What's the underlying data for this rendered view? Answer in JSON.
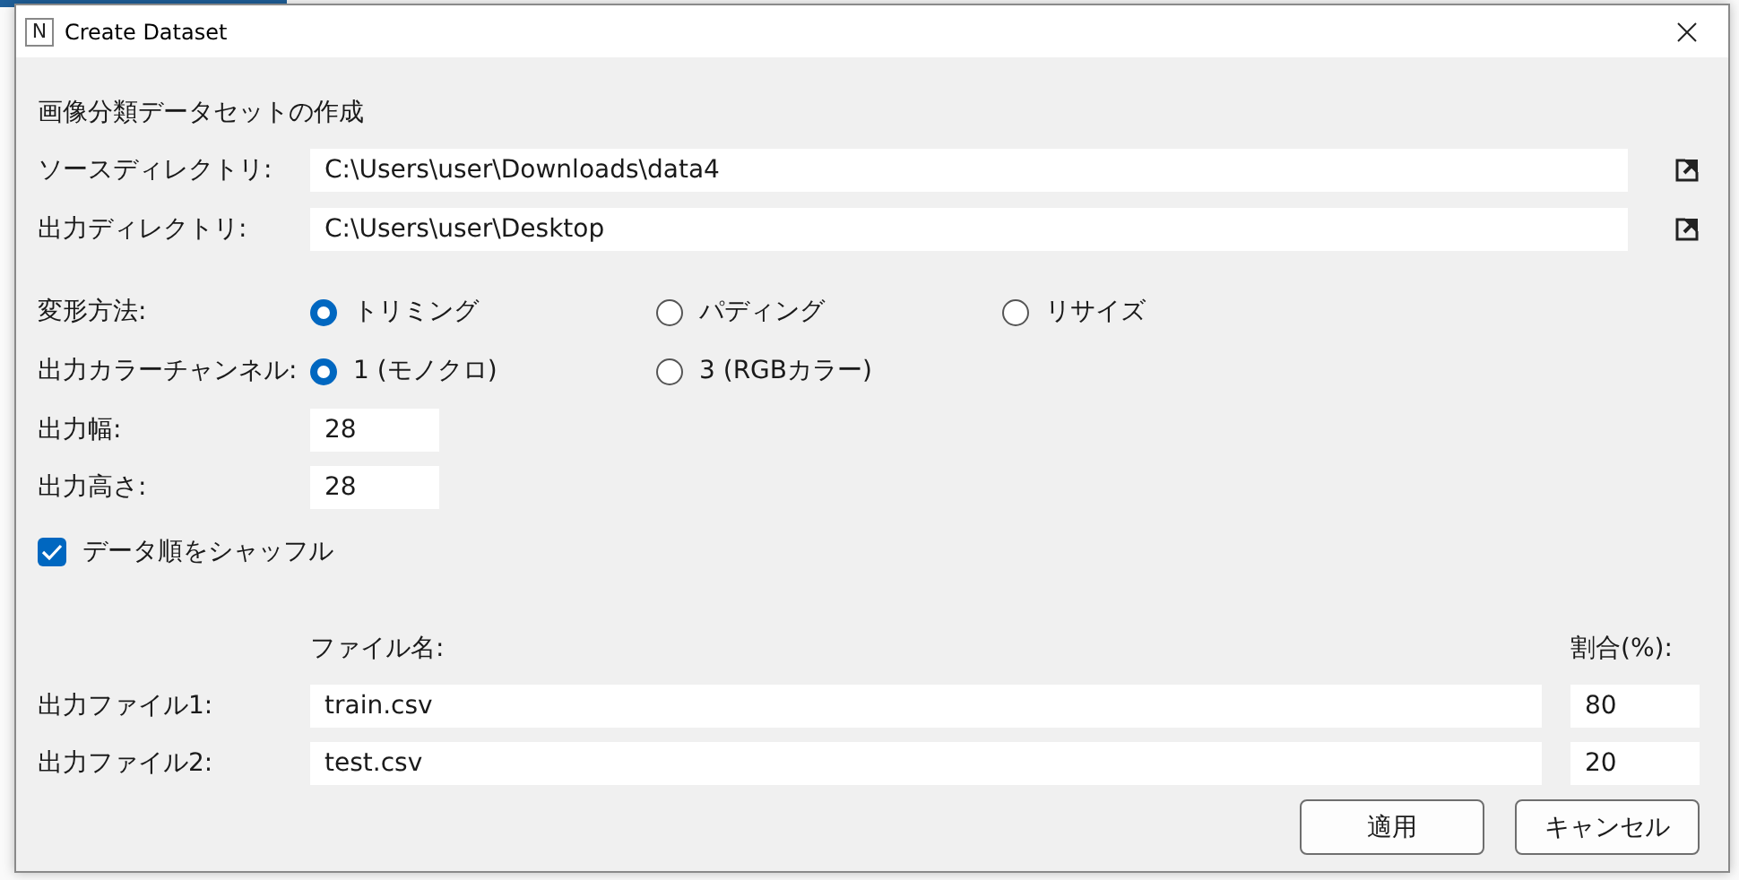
{
  "window": {
    "title": "Create Dataset",
    "app_icon": "N"
  },
  "heading": "画像分類データセットの作成",
  "directories": [
    {
      "label": "ソースディレクトリ:",
      "value": "C:\\Users\\user\\Downloads\\data4"
    },
    {
      "label": "出力ディレクトリ:",
      "value": "C:\\Users\\user\\Desktop"
    }
  ],
  "radio_groups": [
    {
      "label": "変形方法:",
      "options": [
        {
          "label": "トリミング",
          "selected": true
        },
        {
          "label": "パディング",
          "selected": false
        },
        {
          "label": "リサイズ",
          "selected": false
        }
      ]
    },
    {
      "label": "出力カラーチャンネル:",
      "options": [
        {
          "label": "1 (モノクロ)",
          "selected": true
        },
        {
          "label": "3 (RGBカラー)",
          "selected": false
        }
      ]
    }
  ],
  "size_fields": [
    {
      "label": "出力幅:",
      "value": "28"
    },
    {
      "label": "出力高さ:",
      "value": "28"
    }
  ],
  "shuffle": {
    "label": "データ順をシャッフル",
    "checked": true
  },
  "files": {
    "name_header": "ファイル名:",
    "ratio_header": "割合(%):",
    "rows": [
      {
        "label": "出力ファイル1:",
        "name": "train.csv",
        "ratio": "80"
      },
      {
        "label": "出力ファイル2:",
        "name": "test.csv",
        "ratio": "20"
      }
    ]
  },
  "buttons": [
    "適用",
    "キャンセル"
  ]
}
